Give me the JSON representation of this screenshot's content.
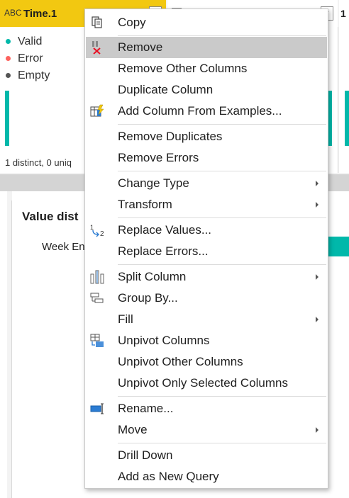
{
  "columns": {
    "left": {
      "type_icon": "ABC",
      "title": "Time.1"
    },
    "right": {
      "title_partial": "1"
    }
  },
  "stats": {
    "valid_label": "Valid",
    "error_label": "Error",
    "empty_label": "Empty",
    "distinct_text": "1 distinct, 0 uniq"
  },
  "lower": {
    "value_dist_title": "Value dist",
    "week_label": "Week En"
  },
  "menu": {
    "copy": "Copy",
    "remove": "Remove",
    "remove_other_columns": "Remove Other Columns",
    "duplicate_column": "Duplicate Column",
    "add_column_from_examples": "Add Column From Examples...",
    "remove_duplicates": "Remove Duplicates",
    "remove_errors": "Remove Errors",
    "change_type": "Change Type",
    "transform": "Transform",
    "replace_values": "Replace Values...",
    "replace_errors": "Replace Errors...",
    "split_column": "Split Column",
    "group_by": "Group By...",
    "fill": "Fill",
    "unpivot_columns": "Unpivot Columns",
    "unpivot_other_columns": "Unpivot Other Columns",
    "unpivot_only_selected_columns": "Unpivot Only Selected Columns",
    "rename": "Rename...",
    "move": "Move",
    "drill_down": "Drill Down",
    "add_as_new_query": "Add as New Query"
  },
  "colors": {
    "accent_teal": "#01b8aa",
    "header_yellow": "#f2c811",
    "valid": "#01b8aa",
    "error": "#fd625e",
    "empty": "#555555",
    "highlight": "#cacaca"
  },
  "icons": {
    "copy": "copy-icon",
    "remove": "remove-column-icon",
    "add_column_from_examples": "add-column-examples-icon",
    "replace_values": "replace-values-icon",
    "split_column": "split-column-icon",
    "group_by": "group-by-icon",
    "unpivot_columns": "unpivot-icon",
    "rename": "rename-icon"
  }
}
